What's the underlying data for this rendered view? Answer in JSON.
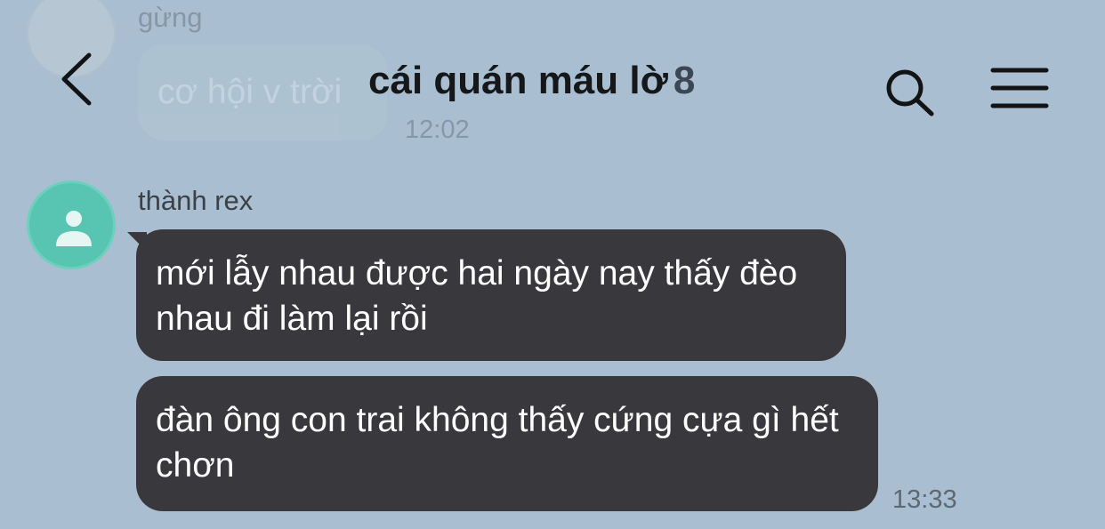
{
  "header": {
    "title": "cái quán máu lờ",
    "member_count": "8"
  },
  "messages": [
    {
      "sender": "gừng",
      "text": "cơ hội v trời",
      "time": "12:02"
    },
    {
      "sender": "thành rex",
      "bubbles": [
        "mới lẫy nhau được hai ngày nay thấy đèo nhau đi làm lại rồi",
        "đàn ông con trai không thấy cứng cựa gì hết chơn"
      ],
      "time": "13:33"
    }
  ],
  "icons": {
    "back": "chevron-left-icon",
    "search": "search-icon",
    "menu": "hamburger-menu-icon",
    "avatar": "person-icon"
  },
  "colors": {
    "background": "#a9bfd1",
    "bubble": "#39393d",
    "avatar": "#58c4b2"
  }
}
